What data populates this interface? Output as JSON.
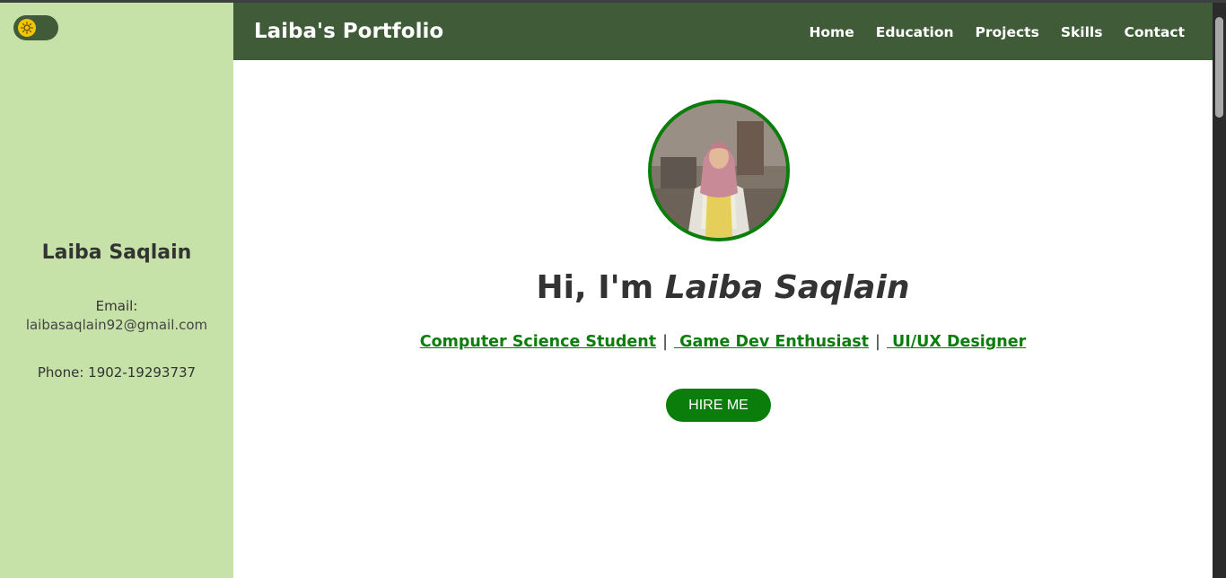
{
  "sidebar": {
    "theme_toggle_icon": "sun-icon",
    "name": "Laiba Saqlain",
    "email_label": "Email:",
    "email": "laibasaqlain92@gmail.com",
    "phone": "Phone: 1902-19293737"
  },
  "header": {
    "brand": "Laiba's Portfolio",
    "nav": [
      "Home",
      "Education",
      "Projects",
      "Skills",
      "Contact"
    ]
  },
  "hero": {
    "greeting": "Hi, I'm ",
    "name": "Laiba Saqlain",
    "roles": [
      "Computer Science Student",
      " Game Dev Enthusiast",
      " UI/UX Designer"
    ],
    "separator": "|",
    "cta": "HIRE ME"
  },
  "colors": {
    "sidebar_bg": "#c7e2a8",
    "header_bg": "#405b38",
    "accent": "#0b7d0b"
  }
}
